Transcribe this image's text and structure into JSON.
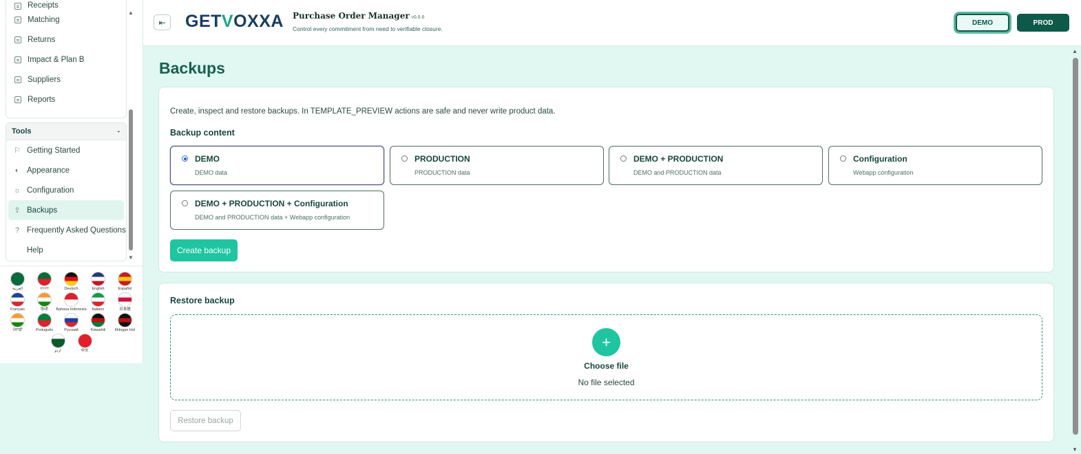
{
  "sidebar": {
    "nav_items": [
      {
        "label": "Receipts",
        "icon": "doc-icon"
      },
      {
        "label": "Matching",
        "icon": "doc-icon"
      },
      {
        "label": "Returns",
        "icon": "doc-icon"
      },
      {
        "label": "Impact & Plan B",
        "icon": "doc-icon"
      },
      {
        "label": "Suppliers",
        "icon": "doc-icon"
      },
      {
        "label": "Reports",
        "icon": "doc-icon"
      }
    ],
    "tools_title": "Tools",
    "tools_caret": "-",
    "tools_items": [
      {
        "label": "Getting Started",
        "icon": "flag-icon",
        "glyph": "⚐"
      },
      {
        "label": "Appearance",
        "icon": "palette-icon",
        "glyph": "◐"
      },
      {
        "label": "Configuration",
        "icon": "gear-icon",
        "glyph": "☼"
      },
      {
        "label": "Backups",
        "icon": "upload-icon",
        "glyph": "⇪",
        "active": true
      },
      {
        "label": "Frequently Asked Questions",
        "icon": "help-icon",
        "glyph": "?"
      },
      {
        "label": "Help",
        "icon": "",
        "glyph": ""
      }
    ],
    "scroll_up": "▲",
    "scroll_down": "▼",
    "languages": [
      [
        {
          "label": "العربية",
          "colors": [
            "#0a6b3a",
            "#0a6b3a"
          ]
        },
        {
          "label": "বাংলা",
          "colors": [
            "#0a6b3a",
            "#e0202a"
          ]
        },
        {
          "label": "Deutsch",
          "colors": [
            "#111111",
            "#dd1111",
            "#ffcc00"
          ]
        },
        {
          "label": "English",
          "colors": [
            "#1f3b7a",
            "#ffffff",
            "#cc1122"
          ]
        },
        {
          "label": "Español",
          "colors": [
            "#c81e1e",
            "#f5c518",
            "#c81e1e"
          ]
        }
      ],
      [
        {
          "label": "Français",
          "colors": [
            "#1f3fa0",
            "#ffffff",
            "#d8262e"
          ]
        },
        {
          "label": "हिन्दी",
          "colors": [
            "#ff9933",
            "#ffffff",
            "#138808"
          ]
        },
        {
          "label": "Bahasa Indonesia",
          "colors": [
            "#e0202a",
            "#ffffff"
          ]
        },
        {
          "label": "Italiano",
          "colors": [
            "#109a48",
            "#ffffff",
            "#d8262e"
          ]
        },
        {
          "label": "日本語",
          "colors": [
            "#ffffff",
            "#d0103a",
            "#ffffff"
          ]
        }
      ],
      [
        {
          "label": "ਪੰਜਾਬੀ",
          "colors": [
            "#ff9933",
            "#ffffff",
            "#138808"
          ]
        },
        {
          "label": "Português",
          "colors": [
            "#0b7a3b",
            "#d8262e"
          ]
        },
        {
          "label": "Русский",
          "colors": [
            "#ffffff",
            "#1f3fa0",
            "#d8262e"
          ]
        },
        {
          "label": "Kiswahili",
          "colors": [
            "#111111",
            "#bb1111",
            "#0b7a3b"
          ]
        },
        {
          "label": "tlhIngan Hol",
          "colors": [
            "#111111",
            "#bb1111",
            "#111111"
          ]
        }
      ],
      [
        {
          "label": "اردو",
          "colors": [
            "#ffffff",
            "#0b5a2b",
            "#0b5a2b"
          ]
        },
        {
          "label": "中文",
          "colors": [
            "#e0202a",
            "#e0202a"
          ]
        }
      ]
    ]
  },
  "header": {
    "collapse_glyph": "⇤",
    "logo_text_a": "GET",
    "logo_text_b": "V",
    "logo_text_c": "OXXA",
    "app_title": "Purchase Order Manager",
    "version": "v0.0.0",
    "subtitle": "Control every commitment from need to verifiable closure.",
    "env_demo": "DEMO",
    "env_prod": "PROD"
  },
  "main": {
    "page_title": "Backups",
    "backup_card": {
      "description": "Create, inspect and restore backups. In TEMPLATE_PREVIEW actions are safe and never write product data.",
      "section_title": "Backup content",
      "options": [
        {
          "title": "DEMO",
          "desc": "DEMO data",
          "selected": true
        },
        {
          "title": "PRODUCTION",
          "desc": "PRODUCTION data",
          "selected": false
        },
        {
          "title": "DEMO + PRODUCTION",
          "desc": "DEMO and PRODUCTION data",
          "selected": false
        },
        {
          "title": "Configuration",
          "desc": "Webapp configuration",
          "selected": false
        },
        {
          "title": "DEMO + PRODUCTION + Configuration",
          "desc": "DEMO and PRODUCTION data + Webapp configuration",
          "selected": false
        }
      ],
      "create_button": "Create backup"
    },
    "restore_card": {
      "title": "Restore backup",
      "plus_glyph": "+",
      "choose_file": "Choose file",
      "no_file": "No file selected",
      "restore_button": "Restore backup"
    }
  },
  "colors": {
    "accent": "#1ec5a0",
    "primary_dark": "#0d5a48",
    "background": "#e0f8f1"
  }
}
